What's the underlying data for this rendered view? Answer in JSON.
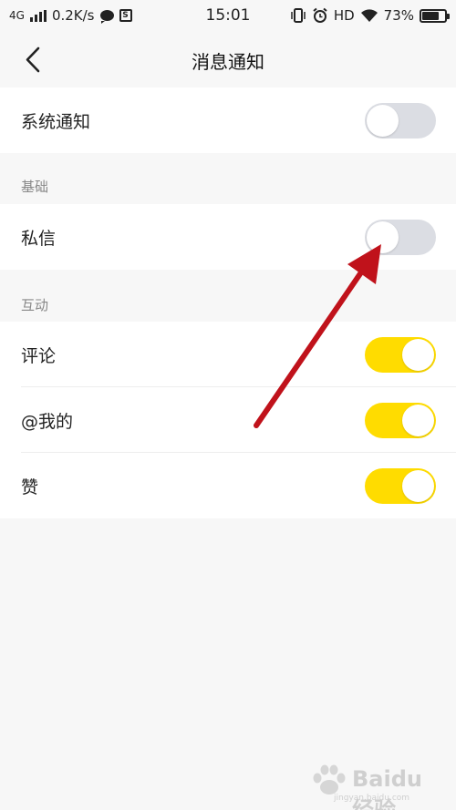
{
  "status_bar": {
    "network": "4G",
    "speed": "0.2K/s",
    "s_icon_text": "S",
    "time": "15:01",
    "hd": "HD",
    "battery": "73%",
    "battery_level": 0.73
  },
  "header": {
    "title": "消息通知"
  },
  "system_notify": {
    "label": "系统通知",
    "enabled": false
  },
  "sections": {
    "basic": {
      "title": "基础",
      "items": [
        {
          "label": "私信",
          "enabled": false
        }
      ]
    },
    "interaction": {
      "title": "互动",
      "items": [
        {
          "label": "评论",
          "enabled": true
        },
        {
          "label": "@我的",
          "enabled": true
        },
        {
          "label": "赞",
          "enabled": true
        }
      ]
    }
  },
  "watermark": {
    "text": "Baidu经验",
    "sub": "jingyan.baidu.com"
  },
  "colors": {
    "toggle_on": "#ffdc00",
    "toggle_off": "#dbdde3",
    "arrow": "#c0121b"
  }
}
